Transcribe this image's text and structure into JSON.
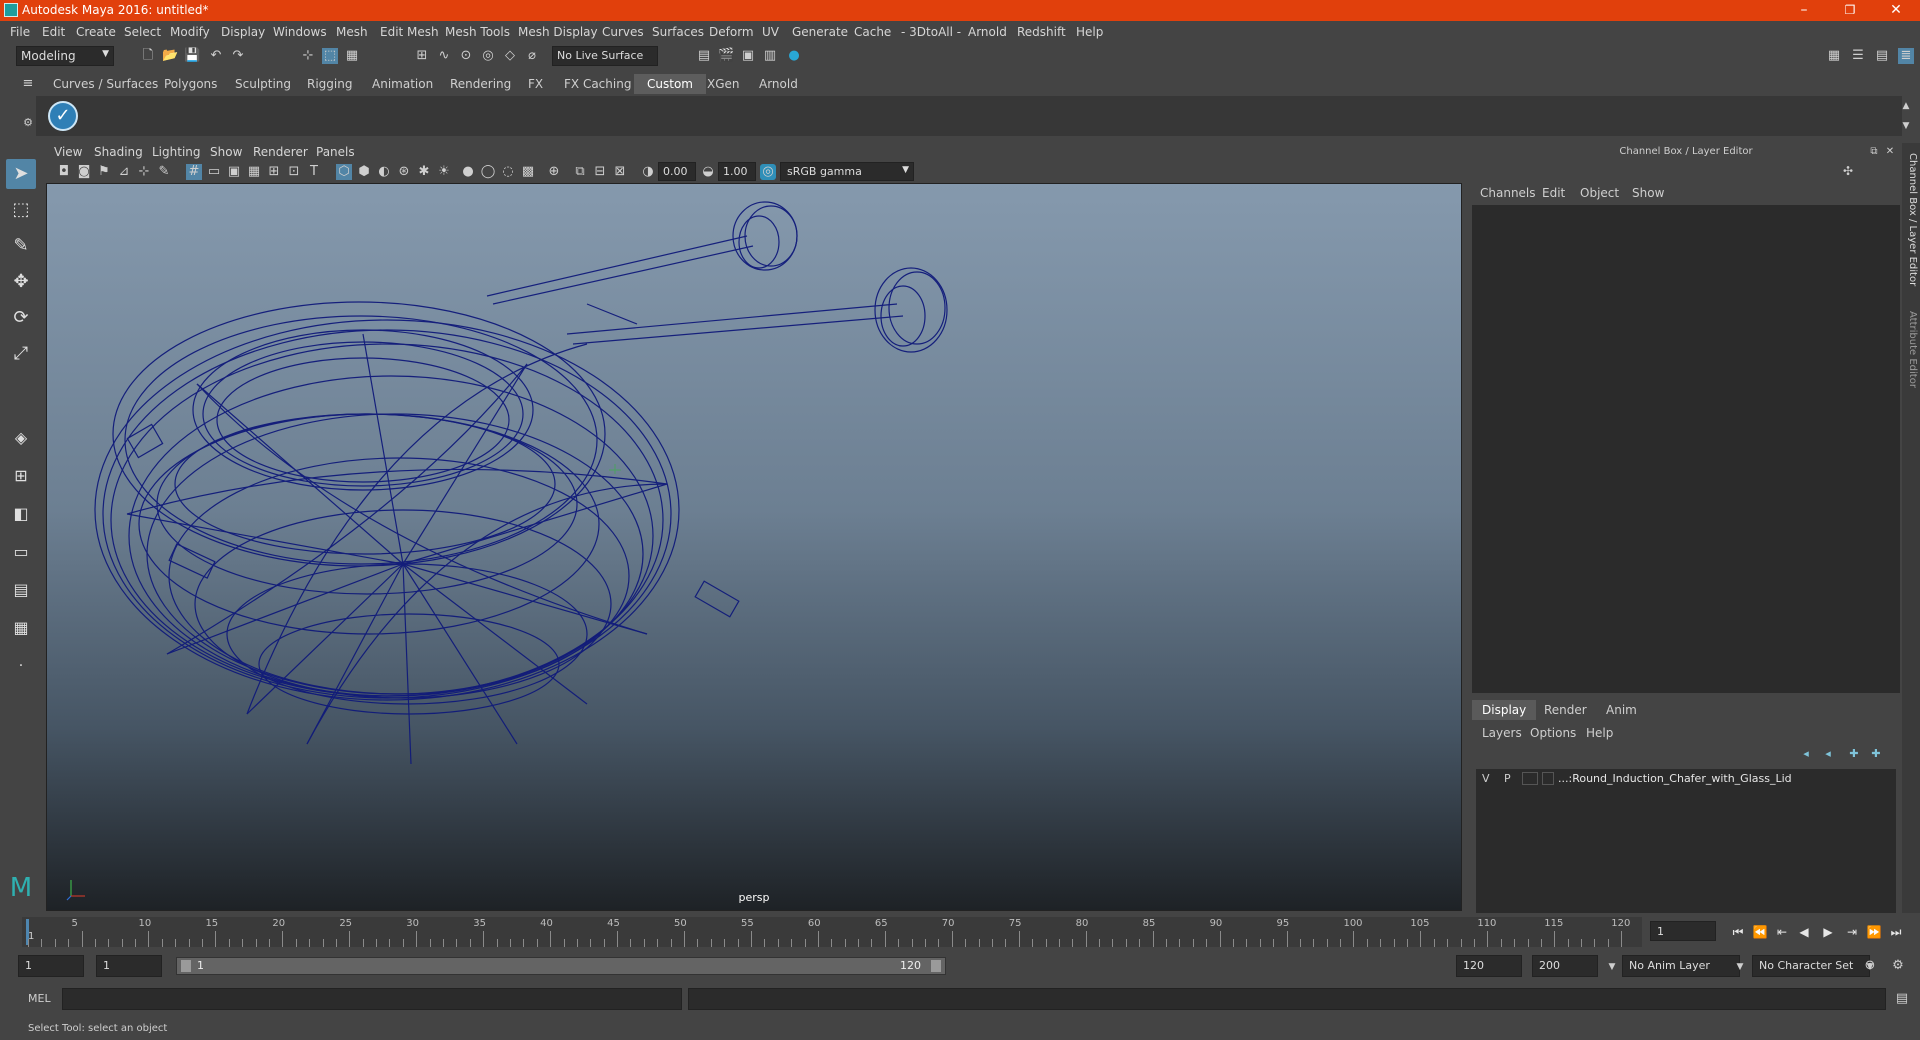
{
  "window": {
    "title": "Autodesk Maya 2016: untitled*",
    "minimize": "–",
    "maximize": "❐",
    "close": "✕"
  },
  "menubar": {
    "items": [
      "File",
      "Edit",
      "Create",
      "Select",
      "Modify",
      "Display",
      "Windows",
      "Mesh",
      "Edit Mesh",
      "Mesh Tools",
      "Mesh Display",
      "Curves",
      "Surfaces",
      "Deform",
      "UV",
      "Generate",
      "Cache",
      "- 3DtoAll -",
      "Arnold",
      "Redshift",
      "Help"
    ]
  },
  "statusline": {
    "menuset": "Modeling",
    "live_surface": "No Live Surface"
  },
  "shelf": {
    "tabs": [
      "Curves / Surfaces",
      "Polygons",
      "Sculpting",
      "Rigging",
      "Animation",
      "Rendering",
      "FX",
      "FX Caching",
      "Custom",
      "XGen",
      "Arnold"
    ],
    "active_tab": "Custom"
  },
  "viewport": {
    "menus": [
      "View",
      "Shading",
      "Lighting",
      "Show",
      "Renderer",
      "Panels"
    ],
    "exposure": "0.00",
    "gamma": "1.00",
    "color_space": "sRGB gamma",
    "camera_label": "persp"
  },
  "channel_box": {
    "title": "Channel Box / Layer Editor",
    "menus": [
      "Channels",
      "Edit",
      "Object",
      "Show"
    ]
  },
  "layer_editor": {
    "tabs": [
      "Display",
      "Render",
      "Anim"
    ],
    "active_tab": "Display",
    "menus": [
      "Layers",
      "Options",
      "Help"
    ],
    "layers": [
      {
        "v": "V",
        "p": "P",
        "name": "...:Round_Induction_Chafer_with_Glass_Lid"
      }
    ]
  },
  "side_tabs": [
    "Channel Box / Layer Editor",
    "Attribute Editor"
  ],
  "timeline": {
    "ticks": [
      "5",
      "10",
      "15",
      "20",
      "25",
      "30",
      "35",
      "40",
      "45",
      "50",
      "55",
      "60",
      "65",
      "70",
      "75",
      "80",
      "85",
      "90",
      "95",
      "100",
      "105",
      "110",
      "115",
      "120"
    ],
    "start_tick": "1",
    "current_frame": "1"
  },
  "range": {
    "start": "1",
    "playback_start": "1",
    "slider_start": "1",
    "slider_end": "120",
    "playback_end": "120",
    "end": "200",
    "anim_layer": "No Anim Layer",
    "character_set": "No Character Set"
  },
  "command_line": {
    "label": "MEL"
  },
  "help_line": {
    "text": "Select Tool: select an object"
  }
}
